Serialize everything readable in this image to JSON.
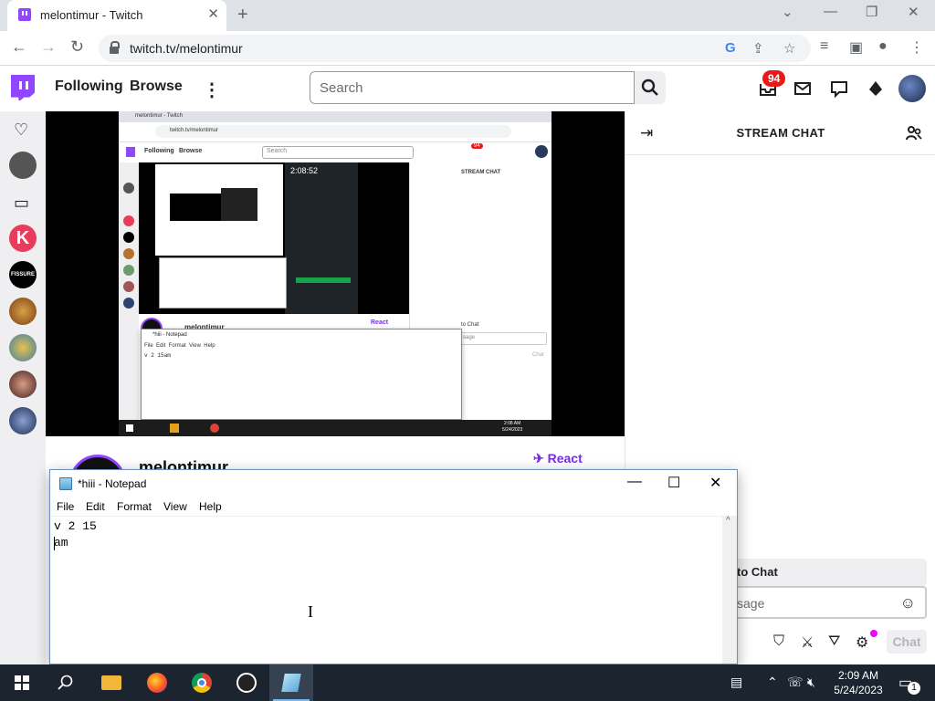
{
  "browser": {
    "tab_title": "melontimur - Twitch",
    "url": "twitch.tv/melontimur"
  },
  "twitch_nav": {
    "following": "Following",
    "browse": "Browse",
    "search_placeholder": "Search",
    "notification_count": "94"
  },
  "player": {
    "inner_tab": "melontimur - Twitch",
    "inner_url": "twitch.tv/melontimur",
    "inner_following": "Following",
    "inner_browse": "Browse",
    "inner_search": "Search",
    "inner_badge": "94",
    "inner_stream_chat": "STREAM CHAT",
    "inner_clock_big": "2:08:52",
    "inner_channel": "melontimur",
    "inner_react": "React",
    "inner_notepad_title": "*hiii - Notepad",
    "inner_notepad_text": "v 2 15am",
    "inner_welcome": "to Chat",
    "inner_msg": "sage",
    "inner_chat_btn": "Chat",
    "inner_time": "2:08 AM",
    "inner_date": "5/24/2023"
  },
  "channel": {
    "name": "melontimur",
    "react_label": "React"
  },
  "chat": {
    "title": "STREAM CHAT",
    "welcome": "to Chat",
    "input_placeholder": "sage",
    "chat_button": "Chat"
  },
  "notepad": {
    "title": "*hiii - Notepad",
    "menu": [
      "File",
      "Edit",
      "Format",
      "View",
      "Help"
    ],
    "lines": [
      "v 2 15",
      "am"
    ]
  },
  "taskbar": {
    "time": "2:09 AM",
    "date": "5/24/2023",
    "notification_count": "1"
  },
  "colors": {
    "twitch_purple": "#9146ff",
    "badge_red": "#e91916",
    "react_purple": "#772ce8",
    "taskbar": "#1c2430"
  }
}
